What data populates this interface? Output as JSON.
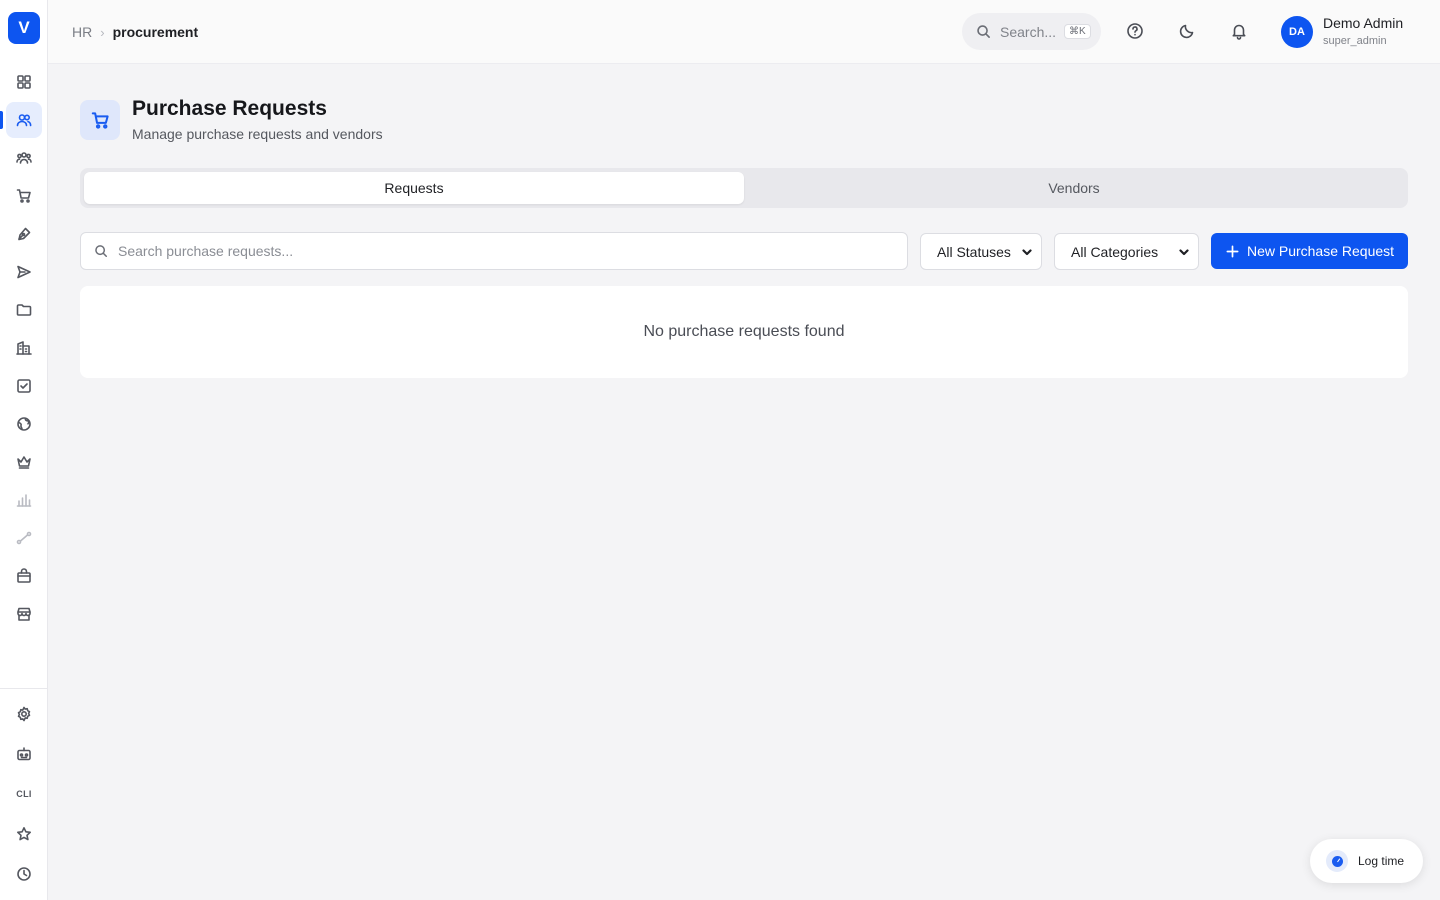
{
  "app": {
    "logo_letter": "V",
    "accent_color": "#0d55f0"
  },
  "sidebar": {
    "items": [
      {
        "name": "dashboard",
        "icon": "grid-icon"
      },
      {
        "name": "people",
        "icon": "users-icon",
        "active": true
      },
      {
        "name": "teams",
        "icon": "team-icon"
      },
      {
        "name": "procurement",
        "icon": "cart-icon"
      },
      {
        "name": "design",
        "icon": "pen-tool-icon"
      },
      {
        "name": "campaigns",
        "icon": "send-icon"
      },
      {
        "name": "files",
        "icon": "folder-icon"
      },
      {
        "name": "buildings",
        "icon": "building-icon"
      },
      {
        "name": "tasks",
        "icon": "checkbox-icon"
      },
      {
        "name": "global",
        "icon": "globe-icon"
      },
      {
        "name": "premium",
        "icon": "crown-icon"
      },
      {
        "name": "analytics",
        "icon": "bar-chart-icon",
        "muted": true
      },
      {
        "name": "workflows",
        "icon": "route-icon",
        "muted": true
      },
      {
        "name": "marketplace",
        "icon": "shopping-bag-icon"
      },
      {
        "name": "store",
        "icon": "store-icon"
      }
    ],
    "bottom_items": [
      {
        "name": "settings",
        "icon": "gear-icon"
      },
      {
        "name": "assistant",
        "icon": "bot-icon"
      },
      {
        "name": "cli",
        "icon": "cli-icon",
        "label": "CLI"
      },
      {
        "name": "favorites",
        "icon": "star-icon"
      },
      {
        "name": "history",
        "icon": "clock-icon"
      }
    ]
  },
  "header": {
    "breadcrumb": {
      "parent": "HR",
      "separator": "›",
      "current": "procurement"
    },
    "search": {
      "placeholder": "Search...",
      "shortcut": "⌘K"
    },
    "icons": [
      "help-icon",
      "moon-icon",
      "bell-icon"
    ],
    "user": {
      "initials": "DA",
      "name": "Demo Admin",
      "role": "super_admin"
    }
  },
  "page": {
    "icon": "cart-icon",
    "title": "Purchase Requests",
    "subtitle": "Manage purchase requests and vendors",
    "tabs": [
      {
        "label": "Requests",
        "active": true
      },
      {
        "label": "Vendors",
        "active": false
      }
    ],
    "toolbar": {
      "search_placeholder": "Search purchase requests...",
      "status_filter": "All Statuses",
      "category_filter": "All Categories",
      "new_button_label": "New Purchase Request"
    },
    "empty_message": "No purchase requests found"
  },
  "log_time": {
    "label": "Log time"
  }
}
